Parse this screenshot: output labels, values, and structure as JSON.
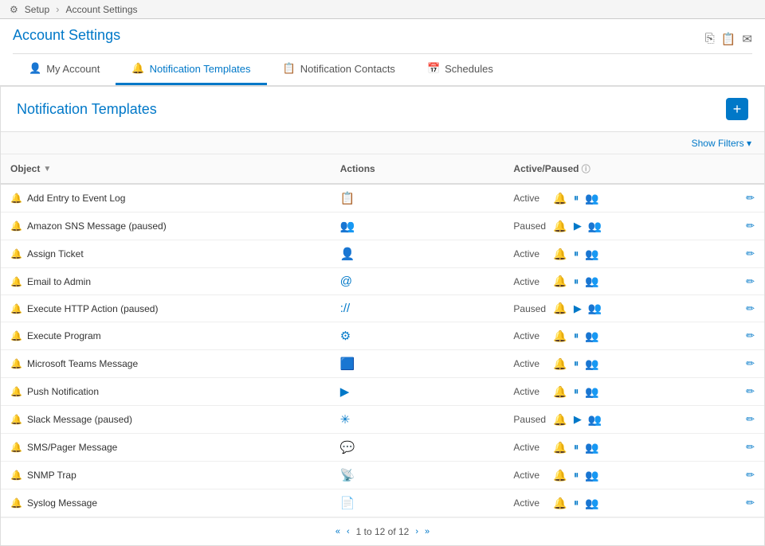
{
  "topbar": {
    "setup": "Setup",
    "account_settings": "Account Settings"
  },
  "page": {
    "title": "Account Settings"
  },
  "tabs": [
    {
      "id": "my-account",
      "label": "My Account",
      "icon": "👤",
      "active": false
    },
    {
      "id": "notification-templates",
      "label": "Notification Templates",
      "icon": "🔔",
      "active": true
    },
    {
      "id": "notification-contacts",
      "label": "Notification Contacts",
      "icon": "📋",
      "active": false
    },
    {
      "id": "schedules",
      "label": "Schedules",
      "icon": "📅",
      "active": false
    }
  ],
  "section": {
    "title": "Notification Templates",
    "add_button_label": "+",
    "show_filters_label": "Show Filters ▾"
  },
  "table": {
    "columns": {
      "object": "Object",
      "actions": "Actions",
      "status": "Active/Paused",
      "edit": ""
    },
    "rows": [
      {
        "name": "Add Entry to Event Log",
        "action_icon": "📋",
        "status": "Active",
        "paused": false
      },
      {
        "name": "Amazon SNS Message (paused)",
        "action_icon": "👥",
        "status": "Paused",
        "paused": true
      },
      {
        "name": "Assign Ticket",
        "action_icon": "👤",
        "status": "Active",
        "paused": false
      },
      {
        "name": "Email to Admin",
        "action_icon": "@",
        "status": "Active",
        "paused": false
      },
      {
        "name": "Execute HTTP Action (paused)",
        "action_icon": "://",
        "status": "Paused",
        "paused": true
      },
      {
        "name": "Execute Program",
        "action_icon": "⚙",
        "status": "Active",
        "paused": false
      },
      {
        "name": "Microsoft Teams Message",
        "action_icon": "🟦",
        "status": "Active",
        "paused": false
      },
      {
        "name": "Push Notification",
        "action_icon": "▶",
        "status": "Active",
        "paused": false
      },
      {
        "name": "Slack Message (paused)",
        "action_icon": "✳",
        "status": "Paused",
        "paused": true
      },
      {
        "name": "SMS/Pager Message",
        "action_icon": "💬",
        "status": "Active",
        "paused": false
      },
      {
        "name": "SNMP Trap",
        "action_icon": "📡",
        "status": "Active",
        "paused": false
      },
      {
        "name": "Syslog Message",
        "action_icon": "📄",
        "status": "Active",
        "paused": false
      }
    ]
  },
  "pagination": {
    "prev_prev": "«",
    "prev": "‹",
    "info": "1 to 12 of 12",
    "next": "›",
    "next_next": "»"
  }
}
